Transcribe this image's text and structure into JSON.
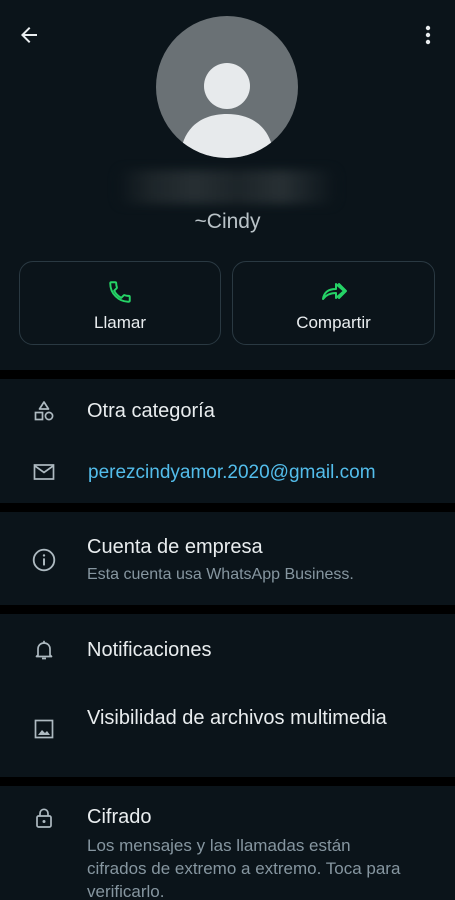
{
  "header": {
    "contact_name_hidden": "",
    "subname": "~Cindy"
  },
  "actions": {
    "call_label": "Llamar",
    "share_label": "Compartir"
  },
  "business_info": {
    "category": "Otra categoría",
    "email": "perezcindyamor.2020@gmail.com"
  },
  "business_account": {
    "title": "Cuenta de empresa",
    "subtitle": "Esta cuenta usa WhatsApp Business."
  },
  "settings": {
    "notifications": "Notificaciones",
    "media_visibility": "Visibilidad de archivos multimedia"
  },
  "encryption": {
    "title": "Cifrado",
    "subtitle": "Los mensajes y las llamadas están cifrados de extremo a extremo. Toca para verificarlo."
  },
  "colors": {
    "background": "#0b141a",
    "separator": "#000000",
    "accent_green": "#25d366",
    "link_blue": "#53bdeb",
    "secondary_text": "#8696a0"
  },
  "icons": {
    "back": "arrow-left-icon",
    "menu": "more-vertical-icon",
    "avatar": "default-person-icon",
    "call": "phone-icon",
    "share": "share-forward-icon",
    "category": "shapes-icon",
    "email": "mail-icon",
    "business": "info-icon",
    "notifications": "bell-icon",
    "media": "image-icon",
    "encryption": "lock-icon"
  }
}
